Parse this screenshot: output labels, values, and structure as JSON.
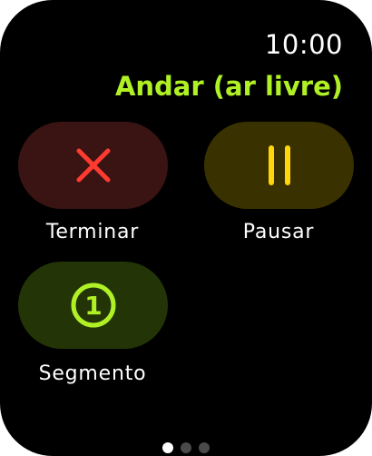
{
  "status": {
    "time": "10:00"
  },
  "workout": {
    "title": "Andar (ar livre)"
  },
  "actions": [
    {
      "id": "end",
      "label": "Terminar",
      "icon": "x-mark-icon",
      "color": "#ff3b30",
      "background": "#3a1313"
    },
    {
      "id": "pause",
      "label": "Pausar",
      "icon": "pause-icon",
      "color": "#ffd60a",
      "background": "#393200"
    },
    {
      "id": "segment",
      "label": "Segmento",
      "icon": "segment-one-icon",
      "icon_text": "1",
      "color": "#b0f126",
      "background": "#233507"
    }
  ],
  "pages": {
    "count": 3,
    "current": 1
  },
  "colors": {
    "background": "#000000",
    "title": "#b0f126",
    "text": "#ffffff"
  }
}
